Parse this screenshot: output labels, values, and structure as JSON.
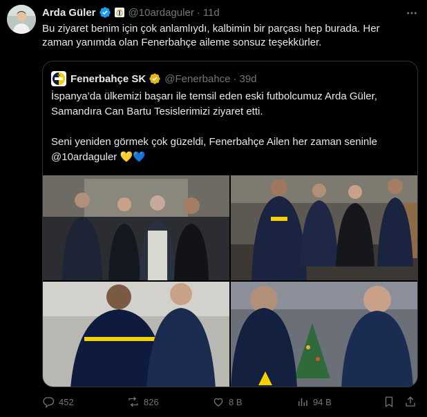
{
  "tweet": {
    "author_name": "Arda Güler",
    "handle": "@10ardaguler",
    "separator": "·",
    "time": "11d",
    "text": "Bu ziyaret benim için çok anlamlıydı, kalbimin bir parçası hep burada. Her\nzaman yanımda olan Fenerbahçe aileme sonsuz teşekkürler."
  },
  "quote": {
    "author_name": "Fenerbahçe SK",
    "handle": "@Fenerbahce",
    "separator": "·",
    "time": "39d",
    "text_line1": "İspanya’da ülkemizi başarı ile temsil eden eski futbolcumuz Arda Güler,\nSamandıra Can Bartu Tesislerimizi ziyaret etti.",
    "text_line2": "Seni yeniden görmek çok güzeldi, Fenerbahçe Ailen her zaman seninle",
    "mention": "@10ardaguler",
    "emojis": "💛💙"
  },
  "actions": {
    "replies": "452",
    "reposts": "826",
    "likes": "8 B",
    "views": "94 B"
  },
  "colors": {
    "background": "#000000",
    "text": "#e7e9ea",
    "muted": "#71767b",
    "border": "#2f3336",
    "verified_blue": "#1d9bf0",
    "verified_gold": "#e2b719",
    "fenerbahce_navy": "#0e1a3c",
    "fenerbahce_yellow": "#f5d000"
  },
  "icons": [
    "verified-badge-icon",
    "real-madrid-affiliate-icon",
    "more-icon",
    "gold-verified-badge-icon",
    "reply-icon",
    "repost-icon",
    "like-icon",
    "views-icon",
    "bookmark-icon",
    "share-icon"
  ]
}
